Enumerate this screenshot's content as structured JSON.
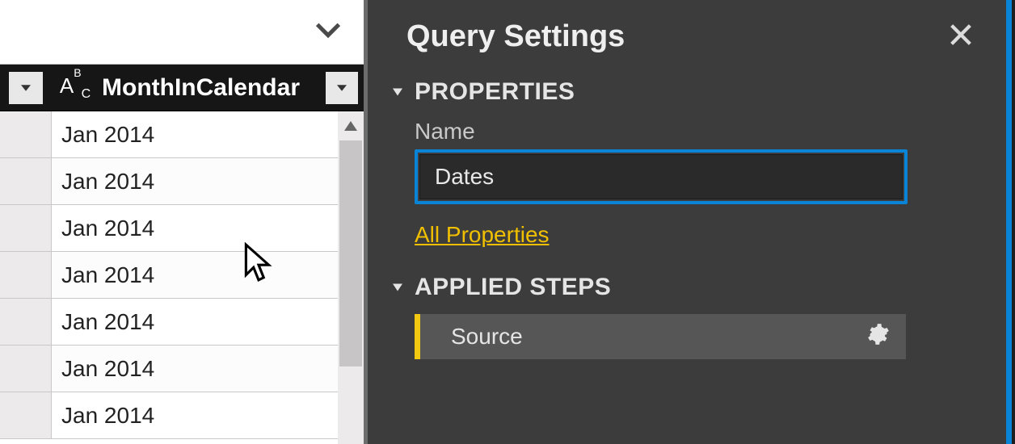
{
  "grid": {
    "column_header": "MonthInCalendar",
    "type_icon_label": "ABC",
    "rows": [
      "Jan 2014",
      "Jan 2014",
      "Jan 2014",
      "Jan 2014",
      "Jan 2014",
      "Jan 2014",
      "Jan 2014"
    ]
  },
  "panel": {
    "title": "Query Settings",
    "properties": {
      "section_label": "PROPERTIES",
      "name_label": "Name",
      "name_value": "Dates",
      "all_properties_label": "All Properties"
    },
    "applied_steps": {
      "section_label": "APPLIED STEPS",
      "items": [
        {
          "label": "Source"
        }
      ]
    }
  },
  "colors": {
    "accent": "#0a84d6",
    "pbi_yellow": "#f2c811",
    "link_yellow": "#f0c000"
  }
}
